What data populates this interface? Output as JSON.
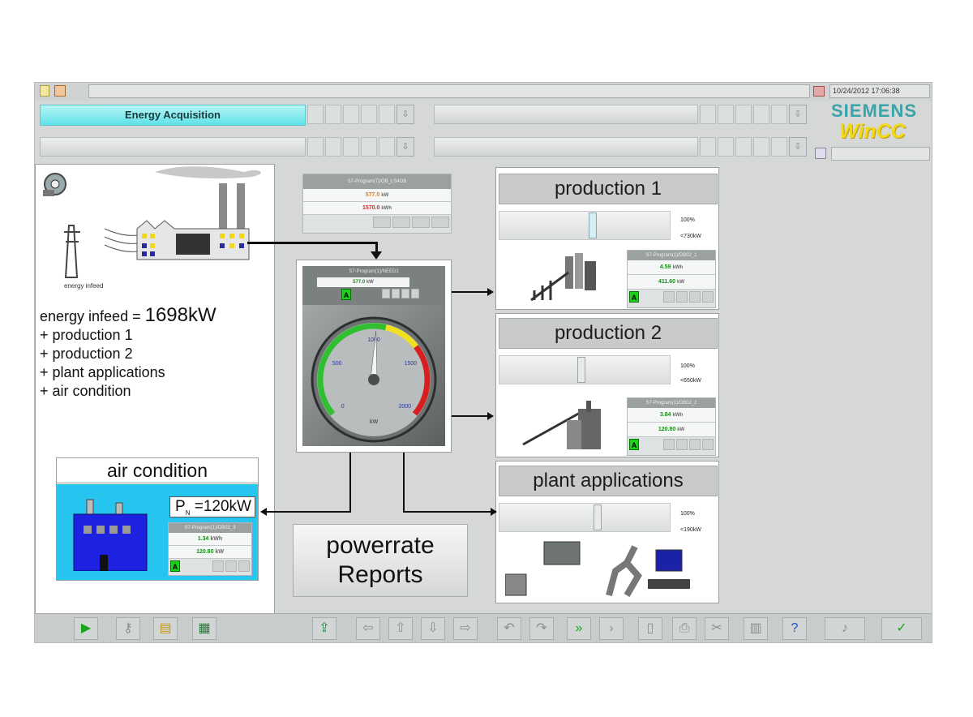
{
  "header": {
    "timestamp": "10/24/2012 17:06:38",
    "tab_active": "Energy Acquisition",
    "brand_top": "SIEMENS",
    "brand_bottom": "WinCC",
    "colors": {
      "brand_teal": "#3aa3a8",
      "brand_yellow": "#f2d81a",
      "tab_cyan": "#5fe2e9"
    }
  },
  "infeed": {
    "caption": "energy infeed",
    "line1_label": "energy infeed =",
    "line1_value": "1698kW",
    "items": [
      "+ production 1",
      "+ production 2",
      "+ plant applications",
      "+ air condition"
    ]
  },
  "top_meter": {
    "title": "S7-Program(7)/OB_LS4OB",
    "value1": "577.0",
    "value1_unit": "kW",
    "value2": "1570.0",
    "value2_unit": "kWh"
  },
  "gauge": {
    "title": "S7-Program(1)/NEED1",
    "display": "577.0",
    "display_unit": "kW",
    "badge": "A",
    "ticks": [
      "0",
      "500",
      "1000",
      "1500",
      "2000"
    ],
    "unit": "kW",
    "needle_value": 1020
  },
  "production1": {
    "title": "production 1",
    "slider_percent": "100%",
    "slider_kw": "<730kW",
    "slider_level": 0.55,
    "meter_title": "S7-Program(1)/DB02_1",
    "value1": "4.59",
    "value1_unit": "kWh",
    "value2": "411.60",
    "value2_unit": "kW",
    "badge": "A"
  },
  "production2": {
    "title": "production 2",
    "slider_percent": "100%",
    "slider_kw": "<650kW",
    "slider_level": 0.48,
    "meter_title": "S7-Program(1)/DB02_2",
    "value1": "3.84",
    "value1_unit": "kWh",
    "value2": "120.80",
    "value2_unit": "kW",
    "badge": "A"
  },
  "plant": {
    "title": "plant applications",
    "slider_percent": "100%",
    "slider_kw": "<190kW",
    "slider_level": 0.58
  },
  "aircon": {
    "title": "air condition",
    "pn_label": "P",
    "pn_sub": "N",
    "pn_value": "=120kW",
    "meter_title": "S7-Program(1)/DB02_3",
    "value1": "1.34",
    "value1_unit": "kWh",
    "value2": "120.80",
    "value2_unit": "kW",
    "badge": "A"
  },
  "reports": {
    "line1": "powerrate",
    "line2": "Reports"
  },
  "footer": {
    "buttons": [
      "play-icon",
      "key-icon",
      "folder-icon",
      "report-icon",
      "export-icon",
      "arrow-left-icon",
      "arrow-up-icon",
      "arrow-down-icon",
      "arrow-right-icon",
      "undo-icon",
      "redo-icon",
      "forward-icon",
      "next-icon",
      "page-icon",
      "print-icon",
      "cut-icon",
      "calc-icon",
      "help-icon",
      "sound-icon",
      "ok-icon"
    ]
  }
}
